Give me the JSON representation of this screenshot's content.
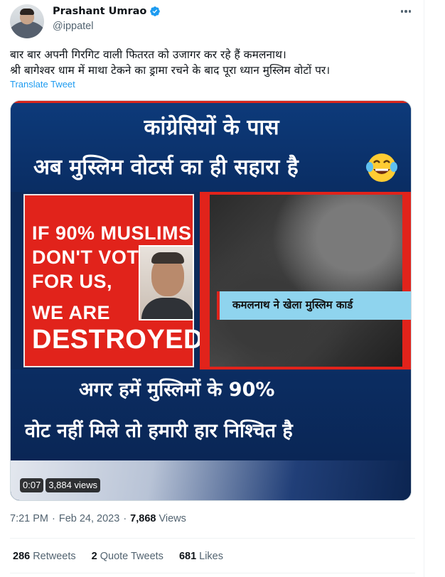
{
  "author": {
    "display_name": "Prashant Umrao",
    "handle": "@ippatel"
  },
  "tweet": {
    "text_line1": "बार बार अपनी गिरगिट वाली फितरत को उजागर कर रहे हैं कमलनाथ।",
    "text_line2": "श्री बागेश्वर धाम में माथा टेकने का ड्रामा रचने के बाद पूरा ध्यान मुस्लिम वोटों पर।",
    "translate_label": "Translate Tweet"
  },
  "media": {
    "headline_line1": "कांग्रेसियों के पास",
    "headline_line2": "अब मुस्लिम वोटर्स का ही सहारा है",
    "quote_line1": "IF 90% MUSLIMS",
    "quote_line2": "DON'T VOTE",
    "quote_line3": "FOR US,",
    "quote_line4": "WE ARE",
    "quote_line5": "DESTROYED",
    "ticker": "कमलनाथ ने खेला मुस्लिम कार्ड",
    "caption_line1": "अगर हमें मुस्लिमों के 90%",
    "caption_line2": "वोट नहीं मिले तो हमारी हार निश्चित है",
    "duration": "0:07",
    "views": "3,884 views",
    "emoji_icon": "face-with-tears-of-joy"
  },
  "meta": {
    "time": "7:21 PM",
    "separator": "·",
    "date": "Feb 24, 2023",
    "separator2": "·",
    "view_count": "7,868",
    "views_label": "Views"
  },
  "stats": {
    "retweets_count": "286",
    "retweets_label": "Retweets",
    "quotes_count": "2",
    "quotes_label": "Quote Tweets",
    "likes_count": "681",
    "likes_label": "Likes"
  },
  "colors": {
    "accent": "#1d9bf0",
    "text": "#0f1419",
    "muted": "#536471"
  }
}
